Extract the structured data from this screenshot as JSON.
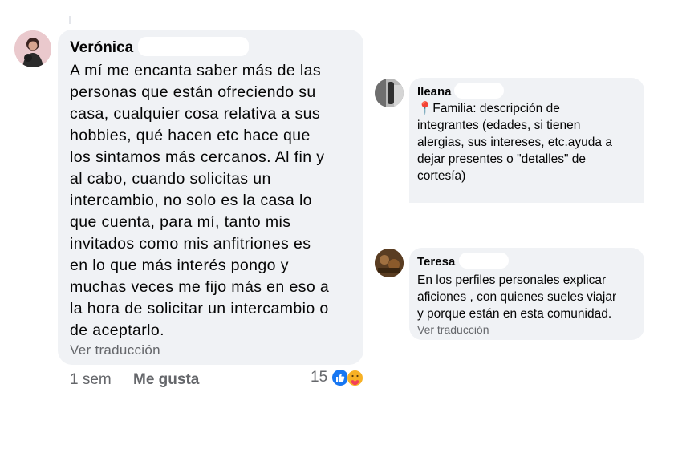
{
  "comments": [
    {
      "author": "Verónica",
      "text": "A mí me encanta saber más de las personas que están ofreciendo su casa, cualquier cosa relativa a sus hobbies, qué hacen  etc hace que los sintamos más cercanos. Al fin y al cabo, cuando solicitas un intercambio, no solo es la casa lo que cuenta, para mí, tanto mis invitados como mis anfitriones es en lo que más interés pongo y muchas veces me fijo más en eso a la hora de solicitar un intercambio o de aceptarlo.",
      "lines": [
        "A mí me encanta saber más de las",
        "personas que están ofreciendo su",
        "casa, cualquier cosa relativa a sus",
        "hobbies, qué hacen  etc hace que",
        "los sintamos más cercanos. Al fin y",
        "al cabo, cuando solicitas un",
        "intercambio, no solo es la casa lo",
        "que cuenta, para mí, tanto mis",
        "invitados como mis anfitriones es",
        "en lo que más interés pongo y",
        "muchas veces me fijo más en eso a",
        "la hora de solicitar un intercambio o",
        "de aceptarlo."
      ],
      "translate_label": "Ver traducción",
      "time": "1 sem",
      "like_label": "Me gusta",
      "reaction_count": "15",
      "reactions": [
        "like-icon",
        "care-icon"
      ]
    },
    {
      "author": "Ileana",
      "lines": [
        "📍Familia: descripción de",
        "integrantes (edades, si tienen",
        "alergias, sus intereses, etc.ayuda a",
        "dejar presentes o \"detalles\" de",
        "cortesía)"
      ]
    },
    {
      "author": "Teresa",
      "lines": [
        "En los perfiles personales explicar",
        "aficiones , con quienes sueles viajar",
        "y porque están en esta comunidad."
      ],
      "translate_label": "Ver traducción"
    }
  ],
  "colors": {
    "bubble": "#f0f2f5",
    "secondary_text": "#65676b",
    "like_blue": "#1877f2",
    "care_yellow": "#f7b125"
  }
}
